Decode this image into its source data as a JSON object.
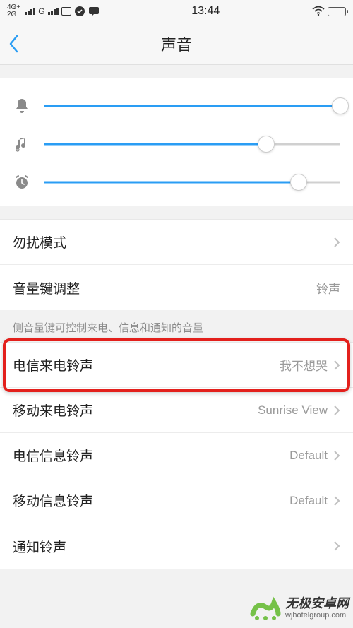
{
  "status": {
    "net_top": "4G+",
    "net_bot": "2G",
    "g_label": "G",
    "time": "13:44"
  },
  "header": {
    "title": "声音"
  },
  "sliders": {
    "ring": 100,
    "media": 75,
    "alarm": 86
  },
  "rows": {
    "dnd": {
      "label": "勿扰模式"
    },
    "volkey": {
      "label": "音量键调整",
      "value": "铃声"
    },
    "telecom_ring": {
      "label": "电信来电铃声",
      "value": "我不想哭"
    },
    "mobile_ring": {
      "label": "移动来电铃声",
      "value": "Sunrise View"
    },
    "telecom_msg": {
      "label": "电信信息铃声",
      "value": "Default"
    },
    "mobile_msg": {
      "label": "移动信息铃声",
      "value": "Default"
    },
    "notify": {
      "label": "通知铃声",
      "value": ""
    }
  },
  "note": "侧音量键可控制来电、信息和通知的音量",
  "watermark": {
    "cn": "无极安卓网",
    "en": "wjhotelgroup.com"
  }
}
